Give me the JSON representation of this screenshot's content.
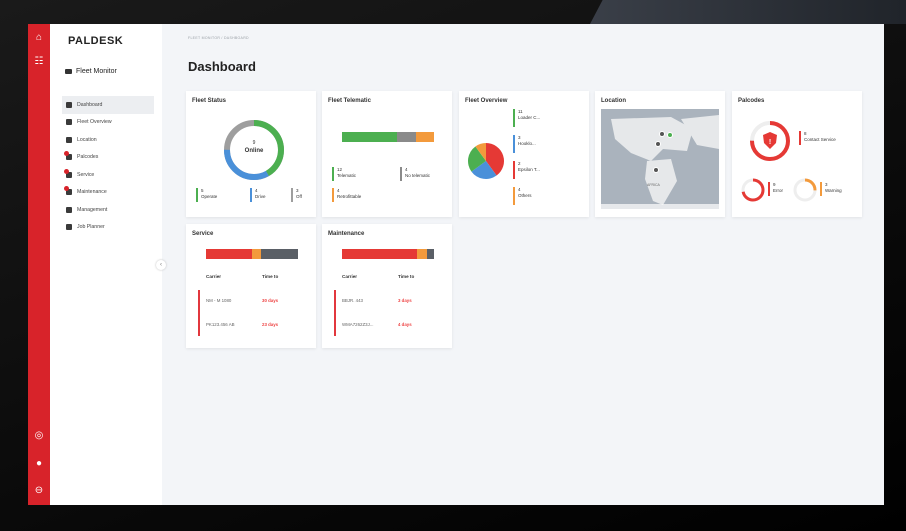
{
  "app": {
    "logo": "PALDESK",
    "module": "Fleet Monitor",
    "breadcrumb": "FLEET MONITOR / DASHBOARD",
    "page_title": "Dashboard"
  },
  "rail": {
    "icons": [
      "home-icon",
      "apps-icon",
      "help-icon",
      "settings-icon",
      "user-icon"
    ]
  },
  "nav": [
    {
      "label": "Dashboard",
      "icon": "dashboard-icon",
      "active": true
    },
    {
      "label": "Fleet Overview",
      "icon": "truck-icon"
    },
    {
      "label": "Location",
      "icon": "pin-icon"
    },
    {
      "label": "Palcodes",
      "icon": "wrench-icon",
      "badge": true
    },
    {
      "label": "Service",
      "icon": "service-icon",
      "badge": true
    },
    {
      "label": "Maintenance",
      "icon": "tool-icon",
      "badge": true
    },
    {
      "label": "Management",
      "icon": "truck-icon"
    },
    {
      "label": "Job Planner",
      "icon": "calendar-icon"
    }
  ],
  "fleet_status": {
    "title": "Fleet Status",
    "donut_value": "9",
    "donut_label": "Online",
    "colors": {
      "operate": "#4caf50",
      "drive": "#4a90d9",
      "off": "#9e9e9e"
    },
    "stats": [
      {
        "value": "5",
        "label": "Operate"
      },
      {
        "value": "4",
        "label": "Drive"
      },
      {
        "value": "3",
        "label": "Off"
      }
    ]
  },
  "fleet_telematic": {
    "title": "Fleet Telematic",
    "bar": [
      {
        "color": "#4caf50",
        "fraction": 0.6
      },
      {
        "color": "#8a8a8a",
        "fraction": 0.2
      },
      {
        "color": "#f39a3c",
        "fraction": 0.2
      }
    ],
    "stats": [
      {
        "value": "12",
        "label": "Telematic"
      },
      {
        "value": "4",
        "label": "No telematic"
      },
      {
        "value": "4",
        "label": "Retrofittable"
      }
    ]
  },
  "fleet_overview": {
    "title": "Fleet Overview",
    "pie": [
      {
        "color": "#e53935",
        "fraction": 0.4
      },
      {
        "color": "#4a90d9",
        "fraction": 0.25
      },
      {
        "color": "#4caf50",
        "fraction": 0.25
      },
      {
        "color": "#f39a3c",
        "fraction": 0.1
      }
    ],
    "items": [
      {
        "value": "11",
        "label": "Loader C..."
      },
      {
        "value": "3",
        "label": "Hooklo..."
      },
      {
        "value": "2",
        "label": "Epsilon T..."
      },
      {
        "value": "4",
        "label": "Others"
      }
    ]
  },
  "location": {
    "title": "Location",
    "map_labels": [
      "AFRICA"
    ]
  },
  "palcodes": {
    "title": "Palcodes",
    "items": [
      {
        "value": "8",
        "label": "Contact Service"
      },
      {
        "value": "9",
        "label": "Error"
      },
      {
        "value": "3",
        "label": "Warning"
      }
    ]
  },
  "service": {
    "title": "Service",
    "headers": [
      "Carrier",
      "Time to"
    ],
    "rows": [
      {
        "carrier": "NM - M 1080",
        "time": "30 days"
      },
      {
        "carrier": "PK123.456 AB",
        "time": "23 days"
      }
    ],
    "bar": [
      {
        "color": "#e53935",
        "fraction": 0.5
      },
      {
        "color": "#f39a3c",
        "fraction": 0.1
      },
      {
        "color": "#5a5f66",
        "fraction": 0.4
      }
    ]
  },
  "maintenance": {
    "title": "Maintenance",
    "headers": [
      "Carrier",
      "Time to"
    ],
    "rows": [
      {
        "carrier": "BBJR. 443",
        "time": "3 days"
      },
      {
        "carrier": "WMA7262Z3J...",
        "time": "4 days"
      }
    ],
    "bar": [
      {
        "color": "#e53935",
        "fraction": 0.82
      },
      {
        "color": "#f39a3c",
        "fraction": 0.1
      },
      {
        "color": "#5a5f66",
        "fraction": 0.08
      }
    ]
  }
}
